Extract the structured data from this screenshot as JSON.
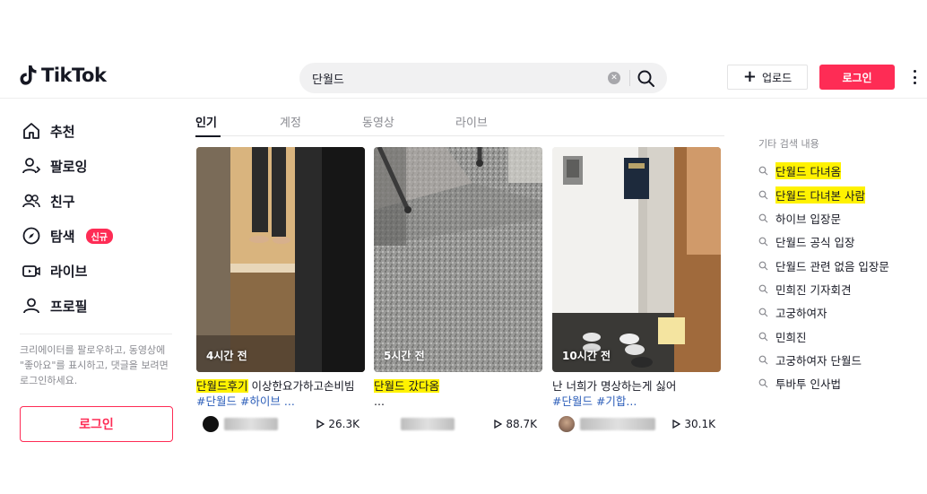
{
  "header": {
    "logo_text": "TikTok",
    "search_value": "단월드",
    "upload_label": "업로드",
    "login_label": "로그인"
  },
  "sidebar": {
    "items": [
      {
        "label": "추천",
        "icon": "home-icon"
      },
      {
        "label": "팔로잉",
        "icon": "following-icon"
      },
      {
        "label": "친구",
        "icon": "friends-icon"
      },
      {
        "label": "탐색",
        "icon": "compass-icon",
        "badge": "신규"
      },
      {
        "label": "라이브",
        "icon": "live-icon"
      },
      {
        "label": "프로필",
        "icon": "profile-icon"
      }
    ],
    "note": "크리에이터를 팔로우하고, 동영상에 \"좋아요\"를 표시하고, 댓글을 보려면 로그인하세요.",
    "login_label": "로그인"
  },
  "tabs": [
    "인기",
    "계정",
    "동영상",
    "라이브"
  ],
  "videos": [
    {
      "time": "4시간 전",
      "desc_highlight": "단월드후기",
      "desc_rest": " 이상한요가하고손비빔",
      "tags": "#단월드 #하이브 ...",
      "views": "26.3K"
    },
    {
      "time": "5시간 전",
      "desc_highlight": "단월드 갔다옴",
      "desc_rest": "",
      "tags": "...",
      "views": "88.7K"
    },
    {
      "time": "10시간 전",
      "desc_highlight": "",
      "desc_rest": "난 너희가 명상하는게 싫어",
      "tags": "#단월드 #기합...",
      "views": "30.1K"
    }
  ],
  "related": {
    "title": "기타 검색 내용",
    "items": [
      {
        "text": "단월드 다녀옴",
        "highlight": true
      },
      {
        "text": "단월드 다녀본 사람",
        "highlight": true
      },
      {
        "text": "하이브 입장문",
        "highlight": false
      },
      {
        "text": "단월드 공식 입장",
        "highlight": false
      },
      {
        "text": "단월드 관련 없음 입장문",
        "highlight": false
      },
      {
        "text": "민희진 기자회견",
        "highlight": false
      },
      {
        "text": "고궁하여자",
        "highlight": false
      },
      {
        "text": "민희진",
        "highlight": false
      },
      {
        "text": "고궁하여자 단월드",
        "highlight": false
      },
      {
        "text": "투바투 인사법",
        "highlight": false
      }
    ]
  },
  "colors": {
    "brand": "#fe2c55",
    "highlight": "#fff200",
    "hashtag": "#2b5db9"
  }
}
